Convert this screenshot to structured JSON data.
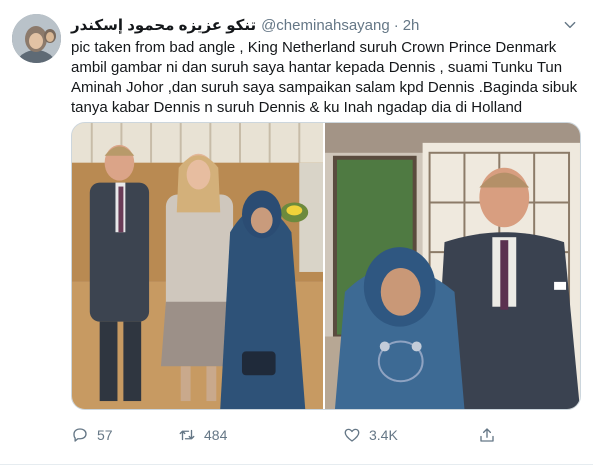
{
  "tweet": {
    "display_name": "تنكو عزيزه محمود إسكندر",
    "handle": "@cheminahsayang",
    "separator": "·",
    "time": "2h",
    "text": "pic taken from bad angle , King Netherland suruh Crown Prince Denmark ambil gambar ni dan suruh saya hantar kepada Dennis , suami Tunku Tun Aminah Johor ,dan suruh saya sampaikan salam kpd  Dennis .Baginda sibuk tanya kabar Dennis n suruh Dennis & ku Inah ngadap dia di Holland",
    "text_lines": [
      "pic taken from bad angle , King Netherland suruh Crown Prince Denmark",
      "ambil gambar ni dan suruh saya hantar kepada Dennis , suami Tunku Tun",
      "Aminah Johor ,dan suruh saya sampaikan salam kpd  Dennis .Baginda sibuk",
      "tanya kabar Dennis n suruh Dennis & ku Inah ngadap dia di Holland"
    ]
  },
  "actions": {
    "reply_count": "57",
    "retweet_count": "484",
    "like_count": "3.4K"
  },
  "icons": {
    "caret": "chevron-down-icon",
    "reply": "reply-icon",
    "retweet": "retweet-icon",
    "like": "heart-icon",
    "share": "share-icon"
  },
  "colors": {
    "text": "#14171a",
    "muted": "#657786",
    "border": "#ccd6dd"
  }
}
